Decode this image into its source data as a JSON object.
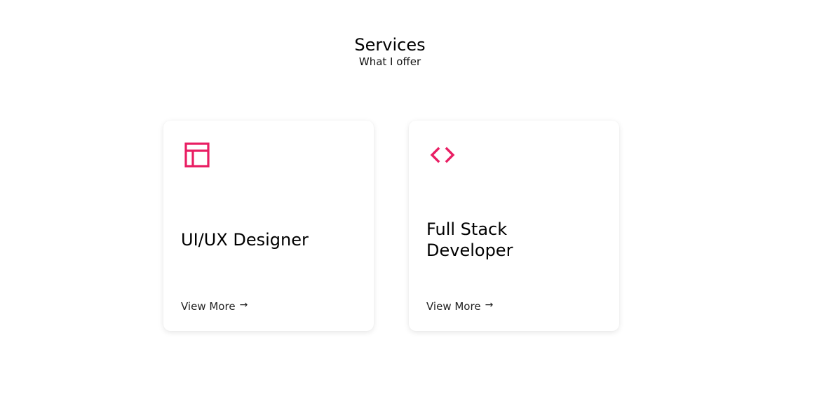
{
  "header": {
    "title": "Services",
    "subtitle": "What I offer"
  },
  "accent_color": "#e91e63",
  "services": [
    {
      "icon": "layout-icon",
      "title_lines": [
        "UI/UX Designer"
      ],
      "link_label": "View More",
      "link_arrow": "→"
    },
    {
      "icon": "code-icon",
      "title_lines": [
        "Full Stack",
        "Developer"
      ],
      "link_label": "View More",
      "link_arrow": "→"
    }
  ]
}
